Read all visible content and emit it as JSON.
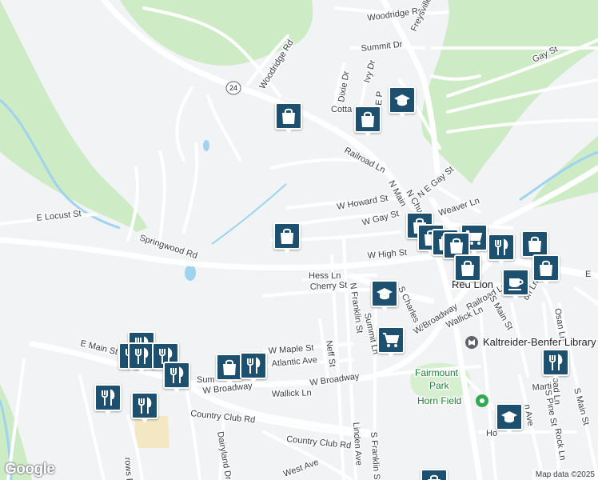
{
  "map": {
    "streets": [
      {
        "id": "woodridge-rd-north",
        "label": "Woodridge Rd"
      },
      {
        "id": "freysville-rd",
        "label": "Freysville Rd"
      },
      {
        "id": "summit-dr",
        "label": "Summit Dr"
      },
      {
        "id": "woodridge-rd",
        "label": "Woodridge Rd"
      },
      {
        "id": "dixie-dr",
        "label": "Dixie Dr"
      },
      {
        "id": "ivy-dr",
        "label": "Ivy Dr"
      },
      {
        "id": "gay-st-east",
        "label": "Gay St"
      },
      {
        "id": "cottage",
        "label": "Cotta"
      },
      {
        "id": "e-p-st",
        "label": "E P"
      },
      {
        "id": "railroad-ln-north",
        "label": "Railroad Ln"
      },
      {
        "id": "n-main",
        "label": "N Main"
      },
      {
        "id": "n-chu",
        "label": "N Chu"
      },
      {
        "id": "n-e-gay-st",
        "label": "N E Gay St"
      },
      {
        "id": "w-howard-st",
        "label": "W Howard St"
      },
      {
        "id": "w-gay-st",
        "label": "W Gay St"
      },
      {
        "id": "weaver-ln",
        "label": "Weaver Ln"
      },
      {
        "id": "e-locust-st",
        "label": "E Locust St"
      },
      {
        "id": "springwood-rd",
        "label": "Springwood Rd"
      },
      {
        "id": "w-high-st",
        "label": "W High St"
      },
      {
        "id": "hess-ln",
        "label": "Hess Ln"
      },
      {
        "id": "cherry-st",
        "label": "Cherry St"
      },
      {
        "id": "n-franklin-st",
        "label": "N Franklin St"
      },
      {
        "id": "s-charles-st",
        "label": "S Charles St"
      },
      {
        "id": "w-broadway-east",
        "label": "W Broadway"
      },
      {
        "id": "railroad-ln",
        "label": "Railroad Ln"
      },
      {
        "id": "wallick-ln-east",
        "label": "Wallick Ln"
      },
      {
        "id": "s-main-st",
        "label": "S Main St"
      },
      {
        "id": "osan-ln",
        "label": "Osan Ln"
      },
      {
        "id": "e-edge",
        "label": "E"
      },
      {
        "id": "w-maple-st",
        "label": "W Maple St"
      },
      {
        "id": "atlantic-ave",
        "label": "Atlantic Ave"
      },
      {
        "id": "neff-st",
        "label": "Neff St"
      },
      {
        "id": "summit-ln",
        "label": "Summit Ln"
      },
      {
        "id": "e-main-st",
        "label": "E Main St"
      },
      {
        "id": "sum",
        "label": "Sum"
      },
      {
        "id": "w-broadway",
        "label": "W Broadway"
      },
      {
        "id": "w-broadway-center",
        "label": "W Broadway"
      },
      {
        "id": "wallick-ln",
        "label": "Wallick Ln"
      },
      {
        "id": "linden-ave",
        "label": "Linden Ave"
      },
      {
        "id": "s-franklin-st",
        "label": "S Franklin St"
      },
      {
        "id": "country-club-rd-west",
        "label": "Country Club Rd"
      },
      {
        "id": "country-club-rd",
        "label": "Country Club Rd"
      },
      {
        "id": "dairyland-dr",
        "label": "Dairyland Dr"
      },
      {
        "id": "west-ave",
        "label": "West Ave"
      },
      {
        "id": "rows-rd",
        "label": "rows Rd"
      },
      {
        "id": "s-pine-st",
        "label": "S Pine St"
      },
      {
        "id": "martin",
        "label": "Martin"
      },
      {
        "id": "railroad-ln-south",
        "label": "Railroad Ln"
      },
      {
        "id": "rock-ln",
        "label": "Rock Ln"
      },
      {
        "id": "n-ave",
        "label": "n Ave"
      },
      {
        "id": "s-main-st-south",
        "label": "S Main St"
      },
      {
        "id": "ho-ln",
        "label": "Ho"
      },
      {
        "id": "on-ln",
        "label": "on Ln"
      }
    ],
    "places": {
      "town": "Red Lion",
      "library": "Kaltreider-Benfer Library",
      "park": "Fairmount Park",
      "field": "Horn Field"
    },
    "route_shield": "24",
    "pins": [
      {
        "type": "shopping",
        "icon": "shopping-bag-icon"
      },
      {
        "type": "shopping",
        "icon": "shopping-bag-icon"
      },
      {
        "type": "school",
        "icon": "graduation-cap-icon"
      },
      {
        "type": "shopping",
        "icon": "shopping-bag-icon"
      },
      {
        "type": "shopping",
        "icon": "shopping-bag-icon"
      },
      {
        "type": "shopping",
        "icon": "shopping-bag-icon"
      },
      {
        "type": "shopping",
        "icon": "shopping-bag-icon"
      },
      {
        "type": "grocery",
        "icon": "shopping-cart-icon"
      },
      {
        "type": "restaurant",
        "icon": "fork-knife-icon"
      },
      {
        "type": "shopping",
        "icon": "shopping-bag-icon"
      },
      {
        "type": "shopping",
        "icon": "shopping-bag-icon"
      },
      {
        "type": "shopping",
        "icon": "shopping-bag-icon"
      },
      {
        "type": "cafe",
        "icon": "coffee-cup-icon"
      },
      {
        "type": "shopping",
        "icon": "shopping-bag-icon"
      },
      {
        "type": "school",
        "icon": "graduation-cap-icon"
      },
      {
        "type": "grocery",
        "icon": "shopping-cart-icon"
      },
      {
        "type": "restaurant",
        "icon": "fork-knife-icon"
      },
      {
        "type": "restaurant",
        "icon": "fork-knife-icon"
      },
      {
        "type": "restaurant",
        "icon": "fork-knife-icon"
      },
      {
        "type": "restaurant",
        "icon": "fork-knife-icon"
      },
      {
        "type": "restaurant",
        "icon": "fork-knife-icon"
      },
      {
        "type": "restaurant",
        "icon": "fork-knife-icon"
      },
      {
        "type": "restaurant",
        "icon": "fork-knife-icon"
      },
      {
        "type": "shopping",
        "icon": "shopping-bag-icon"
      },
      {
        "type": "restaurant",
        "icon": "fork-knife-icon"
      },
      {
        "type": "restaurant",
        "icon": "fork-knife-icon"
      },
      {
        "type": "school",
        "icon": "graduation-cap-icon"
      },
      {
        "type": "shopping",
        "icon": "shopping-bag-icon"
      }
    ],
    "colors": {
      "background": "#f1f3f4",
      "green_area": "#cdebc5",
      "water": "#9fd3ee",
      "road": "#ffffff",
      "main_road": "#ffffff",
      "pin": "#1d4f6e"
    }
  },
  "branding": {
    "logo": "Google",
    "credit": "Map data ©2025"
  }
}
